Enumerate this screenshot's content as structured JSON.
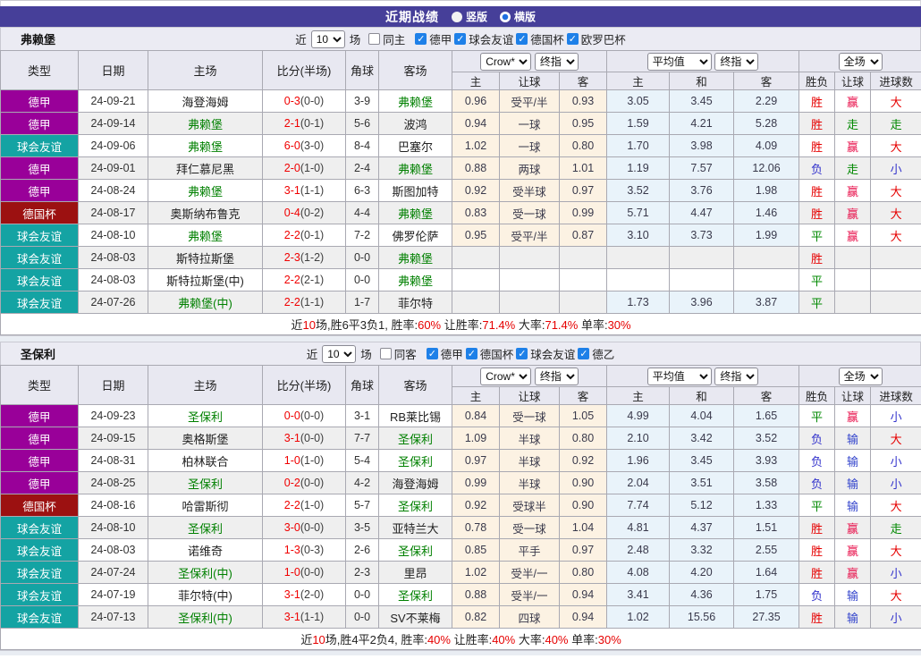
{
  "title_bar": {
    "title": "近期战绩",
    "radios": [
      {
        "label": "竖版",
        "selected": false
      },
      {
        "label": "横版",
        "selected": true
      }
    ]
  },
  "controls": {
    "crow_company": "Crow*",
    "crow_index": "终指",
    "avg_company": "平均值",
    "avg_index": "终指",
    "scope": "全场"
  },
  "columns": {
    "type": "类型",
    "date": "日期",
    "home": "主场",
    "score": "比分(半场)",
    "corner": "角球",
    "away": "客场",
    "crow_sub": [
      "主",
      "让球",
      "客"
    ],
    "avg_sub": [
      "主",
      "和",
      "客"
    ],
    "result_sub": [
      "胜负",
      "让球",
      "进球数"
    ]
  },
  "type_colors": {
    "德甲": "#990099",
    "球会友谊": "#14A3A3",
    "德国杯": "#9C1111"
  },
  "result_colors": {
    "胜": "#E60000",
    "平": "#008800",
    "负": "#3333CC",
    "赢": "#E8114B",
    "输": "#3344CC",
    "走": "#008800",
    "大": "#E60000",
    "小": "#3333CC"
  },
  "sections": [
    {
      "team": "弗赖堡",
      "filter": {
        "near_label": "近",
        "count": "10",
        "unit": "场",
        "same_label": "同主",
        "same_checked": false,
        "leagues": [
          {
            "label": "德甲",
            "checked": true
          },
          {
            "label": "球会友谊",
            "checked": true
          },
          {
            "label": "德国杯",
            "checked": true
          },
          {
            "label": "欧罗巴杯",
            "checked": true
          }
        ]
      },
      "rows": [
        {
          "type": "德甲",
          "date": "24-09-21",
          "home": "海登海姆",
          "hf": false,
          "score": "0-3",
          "half": "(0-0)",
          "corner": "3-9",
          "away": "弗赖堡",
          "af": true,
          "crow": [
            "0.96",
            "受平/半",
            "0.93"
          ],
          "avg": [
            "3.05",
            "3.45",
            "2.29"
          ],
          "res": [
            "胜",
            "赢",
            "大"
          ]
        },
        {
          "type": "德甲",
          "date": "24-09-14",
          "home": "弗赖堡",
          "hf": true,
          "score": "2-1",
          "half": "(0-1)",
          "corner": "5-6",
          "away": "波鸿",
          "af": false,
          "crow": [
            "0.94",
            "一球",
            "0.95"
          ],
          "avg": [
            "1.59",
            "4.21",
            "5.28"
          ],
          "res": [
            "胜",
            "走",
            "走"
          ]
        },
        {
          "type": "球会友谊",
          "date": "24-09-06",
          "home": "弗赖堡",
          "hf": true,
          "score": "6-0",
          "half": "(3-0)",
          "corner": "8-4",
          "away": "巴塞尔",
          "af": false,
          "crow": [
            "1.02",
            "一球",
            "0.80"
          ],
          "avg": [
            "1.70",
            "3.98",
            "4.09"
          ],
          "res": [
            "胜",
            "赢",
            "大"
          ]
        },
        {
          "type": "德甲",
          "date": "24-09-01",
          "home": "拜仁慕尼黑",
          "hf": false,
          "score": "2-0",
          "half": "(1-0)",
          "corner": "2-4",
          "away": "弗赖堡",
          "af": true,
          "crow": [
            "0.88",
            "两球",
            "1.01"
          ],
          "avg": [
            "1.19",
            "7.57",
            "12.06"
          ],
          "res": [
            "负",
            "走",
            "小"
          ]
        },
        {
          "type": "德甲",
          "date": "24-08-24",
          "home": "弗赖堡",
          "hf": true,
          "score": "3-1",
          "half": "(1-1)",
          "corner": "6-3",
          "away": "斯图加特",
          "af": false,
          "crow": [
            "0.92",
            "受半球",
            "0.97"
          ],
          "avg": [
            "3.52",
            "3.76",
            "1.98"
          ],
          "res": [
            "胜",
            "赢",
            "大"
          ]
        },
        {
          "type": "德国杯",
          "date": "24-08-17",
          "home": "奥斯纳布鲁克",
          "hf": false,
          "score": "0-4",
          "half": "(0-2)",
          "corner": "4-4",
          "away": "弗赖堡",
          "af": true,
          "crow": [
            "0.83",
            "受一球",
            "0.99"
          ],
          "avg": [
            "5.71",
            "4.47",
            "1.46"
          ],
          "res": [
            "胜",
            "赢",
            "大"
          ]
        },
        {
          "type": "球会友谊",
          "date": "24-08-10",
          "home": "弗赖堡",
          "hf": true,
          "score": "2-2",
          "half": "(0-1)",
          "corner": "7-2",
          "away": "佛罗伦萨",
          "af": false,
          "crow": [
            "0.95",
            "受平/半",
            "0.87"
          ],
          "avg": [
            "3.10",
            "3.73",
            "1.99"
          ],
          "res": [
            "平",
            "赢",
            "大"
          ]
        },
        {
          "type": "球会友谊",
          "date": "24-08-03",
          "home": "斯特拉斯堡",
          "hf": false,
          "score": "2-3",
          "half": "(1-2)",
          "corner": "0-0",
          "away": "弗赖堡",
          "af": true,
          "crow": [
            "",
            "",
            ""
          ],
          "avg": [
            "",
            "",
            ""
          ],
          "res": [
            "胜",
            "",
            ""
          ]
        },
        {
          "type": "球会友谊",
          "date": "24-08-03",
          "home": "斯特拉斯堡(中)",
          "hf": false,
          "score": "2-2",
          "half": "(2-1)",
          "corner": "0-0",
          "away": "弗赖堡",
          "af": true,
          "crow": [
            "",
            "",
            ""
          ],
          "avg": [
            "",
            "",
            ""
          ],
          "res": [
            "平",
            "",
            ""
          ]
        },
        {
          "type": "球会友谊",
          "date": "24-07-26",
          "home": "弗赖堡(中)",
          "hf": true,
          "score": "2-2",
          "half": "(1-1)",
          "corner": "1-7",
          "away": "菲尔特",
          "af": false,
          "crow": [
            "",
            "",
            ""
          ],
          "avg": [
            "1.73",
            "3.96",
            "3.87"
          ],
          "res": [
            "平",
            "",
            ""
          ]
        }
      ],
      "summary": [
        {
          "t": "近"
        },
        {
          "t": "10",
          "r": 1
        },
        {
          "t": "场,胜6平3负1, 胜率:"
        },
        {
          "t": "60%",
          "r": 1
        },
        {
          "t": " 让胜率:"
        },
        {
          "t": "71.4%",
          "r": 1
        },
        {
          "t": " 大率:"
        },
        {
          "t": "71.4%",
          "r": 1
        },
        {
          "t": " 单率:"
        },
        {
          "t": "30%",
          "r": 1
        }
      ]
    },
    {
      "team": "圣保利",
      "filter": {
        "near_label": "近",
        "count": "10",
        "unit": "场",
        "same_label": "同客",
        "same_checked": false,
        "leagues": [
          {
            "label": "德甲",
            "checked": true
          },
          {
            "label": "德国杯",
            "checked": true
          },
          {
            "label": "球会友谊",
            "checked": true
          },
          {
            "label": "德乙",
            "checked": true
          }
        ]
      },
      "rows": [
        {
          "type": "德甲",
          "date": "24-09-23",
          "home": "圣保利",
          "hf": true,
          "score": "0-0",
          "half": "(0-0)",
          "corner": "3-1",
          "away": "RB莱比锡",
          "af": false,
          "crow": [
            "0.84",
            "受一球",
            "1.05"
          ],
          "avg": [
            "4.99",
            "4.04",
            "1.65"
          ],
          "res": [
            "平",
            "赢",
            "小"
          ]
        },
        {
          "type": "德甲",
          "date": "24-09-15",
          "home": "奥格斯堡",
          "hf": false,
          "score": "3-1",
          "half": "(0-0)",
          "corner": "7-7",
          "away": "圣保利",
          "af": true,
          "crow": [
            "1.09",
            "半球",
            "0.80"
          ],
          "avg": [
            "2.10",
            "3.42",
            "3.52"
          ],
          "res": [
            "负",
            "输",
            "大"
          ]
        },
        {
          "type": "德甲",
          "date": "24-08-31",
          "home": "柏林联合",
          "hf": false,
          "score": "1-0",
          "half": "(1-0)",
          "corner": "5-4",
          "away": "圣保利",
          "af": true,
          "crow": [
            "0.97",
            "半球",
            "0.92"
          ],
          "avg": [
            "1.96",
            "3.45",
            "3.93"
          ],
          "res": [
            "负",
            "输",
            "小"
          ]
        },
        {
          "type": "德甲",
          "date": "24-08-25",
          "home": "圣保利",
          "hf": true,
          "score": "0-2",
          "half": "(0-0)",
          "corner": "4-2",
          "away": "海登海姆",
          "af": false,
          "crow": [
            "0.99",
            "半球",
            "0.90"
          ],
          "avg": [
            "2.04",
            "3.51",
            "3.58"
          ],
          "res": [
            "负",
            "输",
            "小"
          ]
        },
        {
          "type": "德国杯",
          "date": "24-08-16",
          "home": "哈雷斯彻",
          "hf": false,
          "score": "2-2",
          "half": "(1-0)",
          "corner": "5-7",
          "away": "圣保利",
          "af": true,
          "crow": [
            "0.92",
            "受球半",
            "0.90"
          ],
          "avg": [
            "7.74",
            "5.12",
            "1.33"
          ],
          "res": [
            "平",
            "输",
            "大"
          ]
        },
        {
          "type": "球会友谊",
          "date": "24-08-10",
          "home": "圣保利",
          "hf": true,
          "score": "3-0",
          "half": "(0-0)",
          "corner": "3-5",
          "away": "亚特兰大",
          "af": false,
          "crow": [
            "0.78",
            "受一球",
            "1.04"
          ],
          "avg": [
            "4.81",
            "4.37",
            "1.51"
          ],
          "res": [
            "胜",
            "赢",
            "走"
          ]
        },
        {
          "type": "球会友谊",
          "date": "24-08-03",
          "home": "诺维奇",
          "hf": false,
          "score": "1-3",
          "half": "(0-3)",
          "corner": "2-6",
          "away": "圣保利",
          "af": true,
          "crow": [
            "0.85",
            "平手",
            "0.97"
          ],
          "avg": [
            "2.48",
            "3.32",
            "2.55"
          ],
          "res": [
            "胜",
            "赢",
            "大"
          ]
        },
        {
          "type": "球会友谊",
          "date": "24-07-24",
          "home": "圣保利(中)",
          "hf": true,
          "score": "1-0",
          "half": "(0-0)",
          "corner": "2-3",
          "away": "里昂",
          "af": false,
          "crow": [
            "1.02",
            "受半/一",
            "0.80"
          ],
          "avg": [
            "4.08",
            "4.20",
            "1.64"
          ],
          "res": [
            "胜",
            "赢",
            "小"
          ]
        },
        {
          "type": "球会友谊",
          "date": "24-07-19",
          "home": "菲尔特(中)",
          "hf": false,
          "score": "3-1",
          "half": "(2-0)",
          "corner": "0-0",
          "away": "圣保利",
          "af": true,
          "crow": [
            "0.88",
            "受半/一",
            "0.94"
          ],
          "avg": [
            "3.41",
            "4.36",
            "1.75"
          ],
          "res": [
            "负",
            "输",
            "大"
          ]
        },
        {
          "type": "球会友谊",
          "date": "24-07-13",
          "home": "圣保利(中)",
          "hf": true,
          "score": "3-1",
          "half": "(1-1)",
          "corner": "0-0",
          "away": "SV不莱梅",
          "af": false,
          "crow": [
            "0.82",
            "四球",
            "0.94"
          ],
          "avg": [
            "1.02",
            "15.56",
            "27.35"
          ],
          "res": [
            "胜",
            "输",
            "小"
          ]
        }
      ],
      "summary": [
        {
          "t": "近"
        },
        {
          "t": "10",
          "r": 1
        },
        {
          "t": "场,胜4平2负4, 胜率:"
        },
        {
          "t": "40%",
          "r": 1
        },
        {
          "t": " 让胜率:"
        },
        {
          "t": "40%",
          "r": 1
        },
        {
          "t": " 大率:"
        },
        {
          "t": "40%",
          "r": 1
        },
        {
          "t": " 单率:"
        },
        {
          "t": "30%",
          "r": 1
        }
      ]
    }
  ]
}
